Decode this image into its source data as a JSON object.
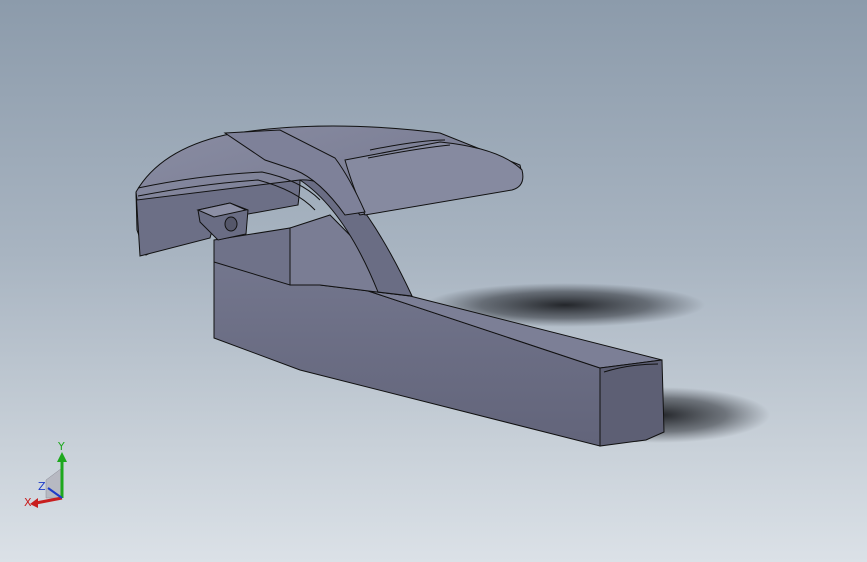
{
  "viewport": {
    "background_top": "#8c9bab",
    "background_bottom": "#dbe1e7"
  },
  "model": {
    "face_light": "#7d8096",
    "face_mid": "#6e7087",
    "face_dark": "#5f6176",
    "edge_color": "#111111"
  },
  "triad": {
    "x_label": "X",
    "y_label": "Y",
    "z_label": "Z",
    "x_color": "#c81e1e",
    "y_color": "#1ea81e",
    "z_color": "#1e3cc8"
  }
}
